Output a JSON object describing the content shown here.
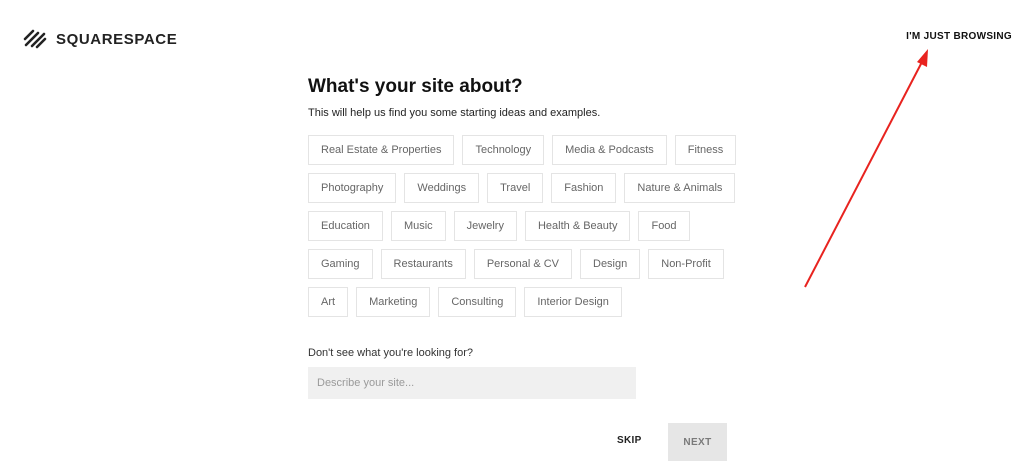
{
  "header": {
    "logo_text": "SQUARESPACE",
    "browse_link": "I'M JUST BROWSING"
  },
  "main": {
    "title": "What's your site about?",
    "subtitle": "This will help us find you some starting ideas and examples.",
    "category_rows": [
      [
        "Real Estate & Properties",
        "Technology",
        "Media & Podcasts",
        "Fitness"
      ],
      [
        "Photography",
        "Weddings",
        "Travel",
        "Fashion",
        "Nature & Animals"
      ],
      [
        "Education",
        "Music",
        "Jewelry",
        "Health & Beauty",
        "Food"
      ],
      [
        "Gaming",
        "Restaurants",
        "Personal & CV",
        "Design",
        "Non-Profit"
      ],
      [
        "Art",
        "Marketing",
        "Consulting",
        "Interior Design"
      ]
    ],
    "prompt_label": "Don't see what you're looking for?",
    "describe_placeholder": "Describe your site...",
    "describe_value": ""
  },
  "footer": {
    "skip_label": "SKIP",
    "next_label": "NEXT"
  },
  "annotation": {
    "arrow_color": "#e8231f"
  },
  "colors": {
    "chip_border": "#e4e4e4",
    "chip_text": "#666666",
    "input_bg": "#f0f0f0",
    "next_bg": "#e6e6e6"
  }
}
